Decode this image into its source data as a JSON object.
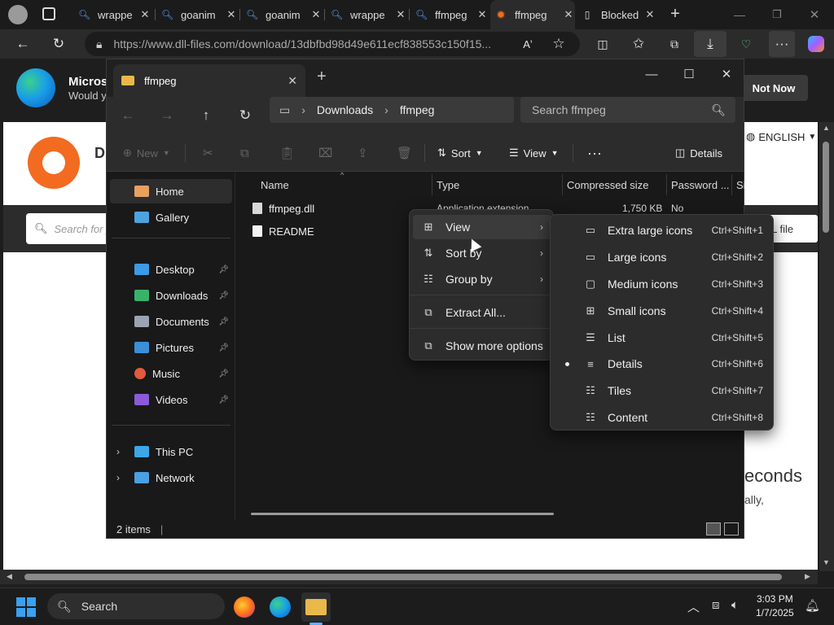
{
  "browser": {
    "tabs": [
      {
        "title": "wrappe",
        "icon": "search-icon"
      },
      {
        "title": "goanim",
        "icon": "search-icon"
      },
      {
        "title": "goanim",
        "icon": "search-icon"
      },
      {
        "title": "wrappe",
        "icon": "search-icon"
      },
      {
        "title": "ffmpeg",
        "icon": "search-icon"
      },
      {
        "title": "ffmpeg",
        "icon": "gear-site-icon"
      },
      {
        "title": "Blocked",
        "icon": "page-icon"
      }
    ],
    "active_tab": 5,
    "url": "https://www.dll-files.com/download/13dbfbd98d49e611ecf838553c150f15..."
  },
  "edge_banner": {
    "title": "Microsc",
    "subtitle": "Would y",
    "not_now": "Not Now"
  },
  "website": {
    "heading_fragment": "D",
    "language": "ENGLISH",
    "search_placeholder": "Search for y",
    "dll_button": "LL file",
    "seconds_text": "econds",
    "ally_text": "ally,"
  },
  "explorer": {
    "tab_title": "ffmpeg",
    "path": [
      "Downloads",
      "ffmpeg"
    ],
    "search_placeholder": "Search ffmpeg",
    "toolbar": {
      "new": "New",
      "sort": "Sort",
      "view": "View",
      "details": "Details"
    },
    "sidebar": [
      {
        "label": "Home",
        "icon": "home-icon",
        "selected": true
      },
      {
        "label": "Gallery",
        "icon": "gallery-icon"
      },
      {
        "label": "Desktop",
        "icon": "desktop-icon",
        "pinned": true
      },
      {
        "label": "Downloads",
        "icon": "download-icon",
        "pinned": true
      },
      {
        "label": "Documents",
        "icon": "documents-icon",
        "pinned": true
      },
      {
        "label": "Pictures",
        "icon": "pictures-icon",
        "pinned": true
      },
      {
        "label": "Music",
        "icon": "music-icon",
        "pinned": true
      },
      {
        "label": "Videos",
        "icon": "videos-icon",
        "pinned": true
      },
      {
        "label": "This PC",
        "icon": "pc-icon"
      },
      {
        "label": "Network",
        "icon": "network-icon"
      }
    ],
    "columns": [
      "Name",
      "Type",
      "Compressed size",
      "Password ...",
      "Si"
    ],
    "files": [
      {
        "name": "ffmpeg.dll",
        "type": "Application extension",
        "size": "1,750 KB",
        "password": "No"
      },
      {
        "name": "README",
        "type": "",
        "size": "",
        "password": ""
      }
    ],
    "status": "2 items"
  },
  "context_menu": {
    "items": [
      {
        "label": "View",
        "icon": "grid-icon",
        "submenu": true
      },
      {
        "label": "Sort by",
        "icon": "sort-icon",
        "submenu": true
      },
      {
        "label": "Group by",
        "icon": "group-icon",
        "submenu": true
      },
      {
        "label": "Extract All...",
        "icon": "extract-icon"
      },
      {
        "label": "Show more options",
        "icon": "more-options-icon"
      }
    ]
  },
  "view_submenu": {
    "items": [
      {
        "label": "Extra large icons",
        "shortcut": "Ctrl+Shift+1"
      },
      {
        "label": "Large icons",
        "shortcut": "Ctrl+Shift+2"
      },
      {
        "label": "Medium icons",
        "shortcut": "Ctrl+Shift+3"
      },
      {
        "label": "Small icons",
        "shortcut": "Ctrl+Shift+4"
      },
      {
        "label": "List",
        "shortcut": "Ctrl+Shift+5"
      },
      {
        "label": "Details",
        "shortcut": "Ctrl+Shift+6",
        "selected": true
      },
      {
        "label": "Tiles",
        "shortcut": "Ctrl+Shift+7"
      },
      {
        "label": "Content",
        "shortcut": "Ctrl+Shift+8"
      }
    ]
  },
  "taskbar": {
    "search": "Search",
    "time": "3:03 PM",
    "date": "1/7/2025"
  },
  "colors": {
    "accent": "#0078d4",
    "folder": "#e8b94a",
    "site_orange": "#f26b21"
  }
}
